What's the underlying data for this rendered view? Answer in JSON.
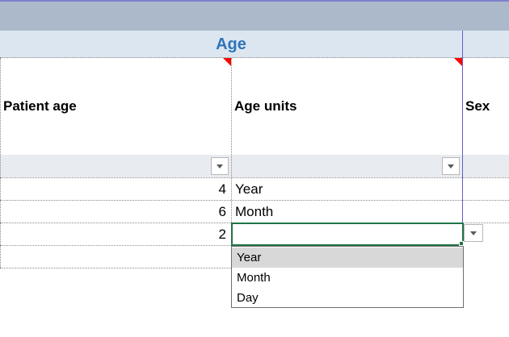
{
  "group_header": {
    "title": "Age"
  },
  "columns": [
    {
      "label": "Patient age"
    },
    {
      "label": "Age units"
    },
    {
      "label": "Sex"
    }
  ],
  "rows": [
    {
      "age": "4",
      "units": "Year"
    },
    {
      "age": "6",
      "units": "Month"
    },
    {
      "age": "2",
      "units": ""
    }
  ],
  "dropdown": {
    "options": [
      "Year",
      "Month",
      "Day"
    ],
    "selected": "Year"
  },
  "icons": {
    "filter": "chevron-down-icon",
    "comment": "comment-indicator-icon",
    "dropdown": "dropdown-arrow-icon"
  },
  "colors": {
    "top_band": "#acb9ca",
    "group_header_bg": "#dce6f1",
    "group_title": "#2e75b6",
    "active_border": "#217346",
    "comment_marker": "#ff0000",
    "dropdown_selected": "#d8d8d8"
  }
}
